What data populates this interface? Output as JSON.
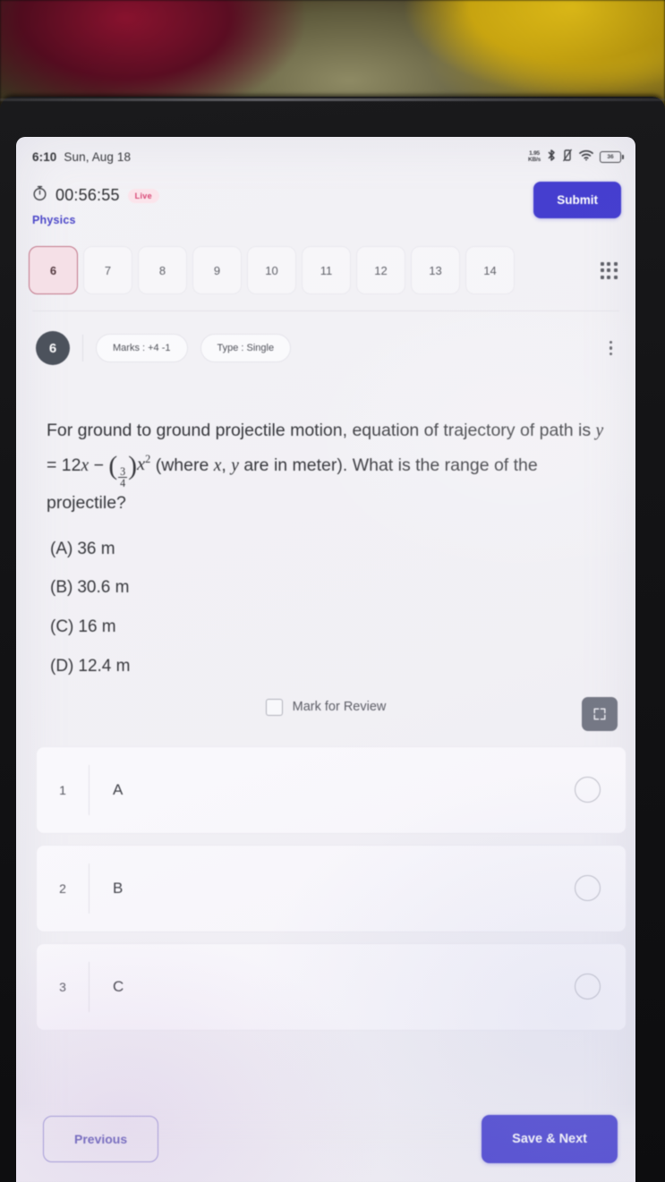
{
  "status_bar": {
    "time": "6:10",
    "date": "Sun, Aug 18",
    "network_speed_top": "1.95",
    "network_speed_bottom": "KB/s",
    "battery_level": "36",
    "icons": [
      "network-speed-icon",
      "bluetooth-icon",
      "vibrate-icon",
      "wifi-icon",
      "battery-icon"
    ]
  },
  "exam_header": {
    "timer": "00:56:55",
    "live_badge": "Live",
    "subject": "Physics",
    "submit_label": "Submit",
    "timer_icon": "stopwatch-icon"
  },
  "question_tabs": {
    "items": [
      {
        "label": "6",
        "active": true
      },
      {
        "label": "7",
        "active": false
      },
      {
        "label": "8",
        "active": false
      },
      {
        "label": "9",
        "active": false
      },
      {
        "label": "10",
        "active": false
      },
      {
        "label": "11",
        "active": false
      },
      {
        "label": "12",
        "active": false
      },
      {
        "label": "13",
        "active": false
      },
      {
        "label": "14",
        "active": false
      }
    ],
    "grid_icon": "grid-icon"
  },
  "question_meta": {
    "number": "6",
    "marks_chip": "Marks :  +4  -1",
    "type_chip": "Type :  Single",
    "menu_icon": "kebab-menu-icon"
  },
  "question": {
    "text_part1": "For ground to ground projectile motion, equation of trajectory of path is ",
    "eq_y": "y",
    "eq_equals": " = 12",
    "eq_x1": "x",
    "eq_minus": " − ",
    "frac_num": "3",
    "frac_den": "4",
    "eq_xsq_base": "x",
    "eq_xsq_exp": "2",
    "text_part2": " (where ",
    "var_x": "x",
    "text_comma": ", ",
    "var_y": "y",
    "text_part3": " are in meter). What is the range of the projectile?"
  },
  "options": [
    {
      "key": "(A)",
      "text": "36 m"
    },
    {
      "key": "(B)",
      "text": "30.6 m"
    },
    {
      "key": "(C)",
      "text": "16 m"
    },
    {
      "key": "(D)",
      "text": "12.4 m"
    }
  ],
  "fullscreen_button": {
    "icon": "fullscreen-expand-icon"
  },
  "mark_for_review": {
    "label": "Mark for Review",
    "checked": false
  },
  "answer_rows": [
    {
      "index": "1",
      "letter": "A",
      "selected": false
    },
    {
      "index": "2",
      "letter": "B",
      "selected": false
    },
    {
      "index": "3",
      "letter": "C",
      "selected": false
    }
  ],
  "bottom_nav": {
    "previous_label": "Previous",
    "save_next_label": "Save & Next"
  },
  "colors": {
    "accent_indigo": "#3730d8",
    "active_tab_pink": "#f6dfe6",
    "active_tab_border": "#c2687f",
    "live_badge_text": "#e0356c",
    "screen_bg": "#f2f1f5"
  }
}
